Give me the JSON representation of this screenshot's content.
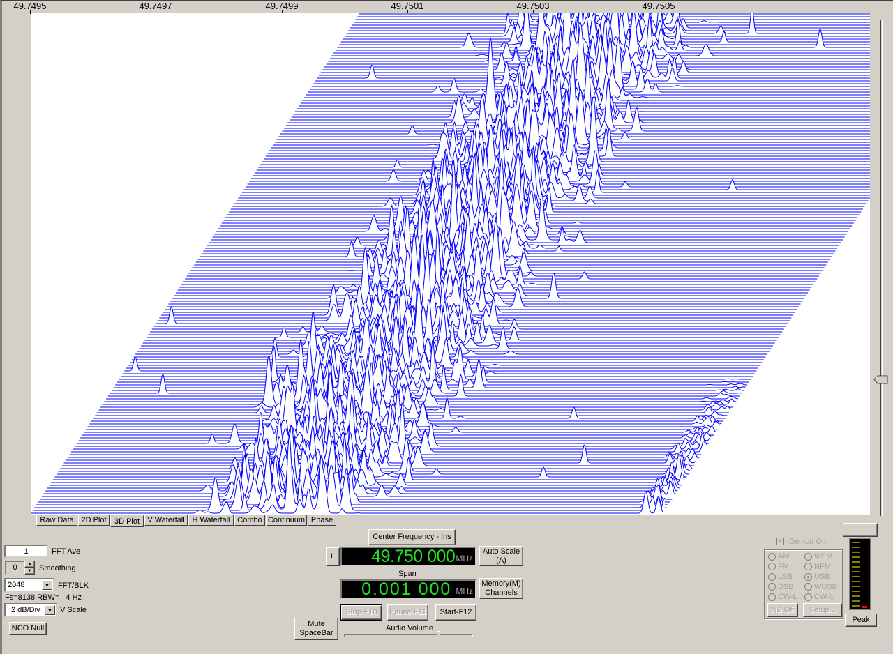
{
  "plot": {
    "view": "3D Plot",
    "trace_color": "#0000ff",
    "x_ticks": [
      "49.7495",
      "49.7497",
      "49.7499",
      "49.7501",
      "49.7503",
      "49.7505"
    ]
  },
  "tabs": [
    "Raw Data",
    "2D Plot",
    "3D Plot",
    "V Waterfall",
    "H Waterfall",
    "Combo",
    "Continuum",
    "Phase"
  ],
  "selected_tab": "3D Plot",
  "left": {
    "fft_ave_value": "1",
    "fft_ave_label": "FFT Ave",
    "smoothing_value": "0",
    "smoothing_label": "Smoothing",
    "fft_blk_value": "2048",
    "fft_blk_label": "FFT/BLK",
    "fs_rbw": "Fs=8138 RBW=   4 Hz",
    "vscale_value": "2 dB/Div",
    "vscale_label": "V Scale",
    "nco_null": "NCO Null"
  },
  "center": {
    "center_freq_button": "Center Frequency - Ins",
    "lock_button": "L",
    "center_freq_value": "49.750 000",
    "unit": "MHz",
    "auto_scale_line1": "Auto Scale",
    "auto_scale_line2": "(A)",
    "span_label": "Span",
    "span_value": "0.001 000",
    "memory_line1": "Memory(M)",
    "memory_line2": "Channels",
    "stop": "Stop-F10",
    "pause": "Pause-F11",
    "start": "Start-F12",
    "mute_line1": "Mute",
    "mute_line2": "SpaceBar",
    "audio_volume_label": "Audio Volume",
    "audio_volume_level": 0.74
  },
  "right": {
    "demod_on": "Demod On",
    "modes": [
      "AM",
      "WFM",
      "FM",
      "NFM",
      "LSB",
      "USB",
      "DSB",
      "WUSB",
      "CW-L",
      "CW-U"
    ],
    "selected_mode": "USB",
    "nb_off": "NB Off",
    "setup": "Setup...",
    "peak": "Peak"
  }
}
